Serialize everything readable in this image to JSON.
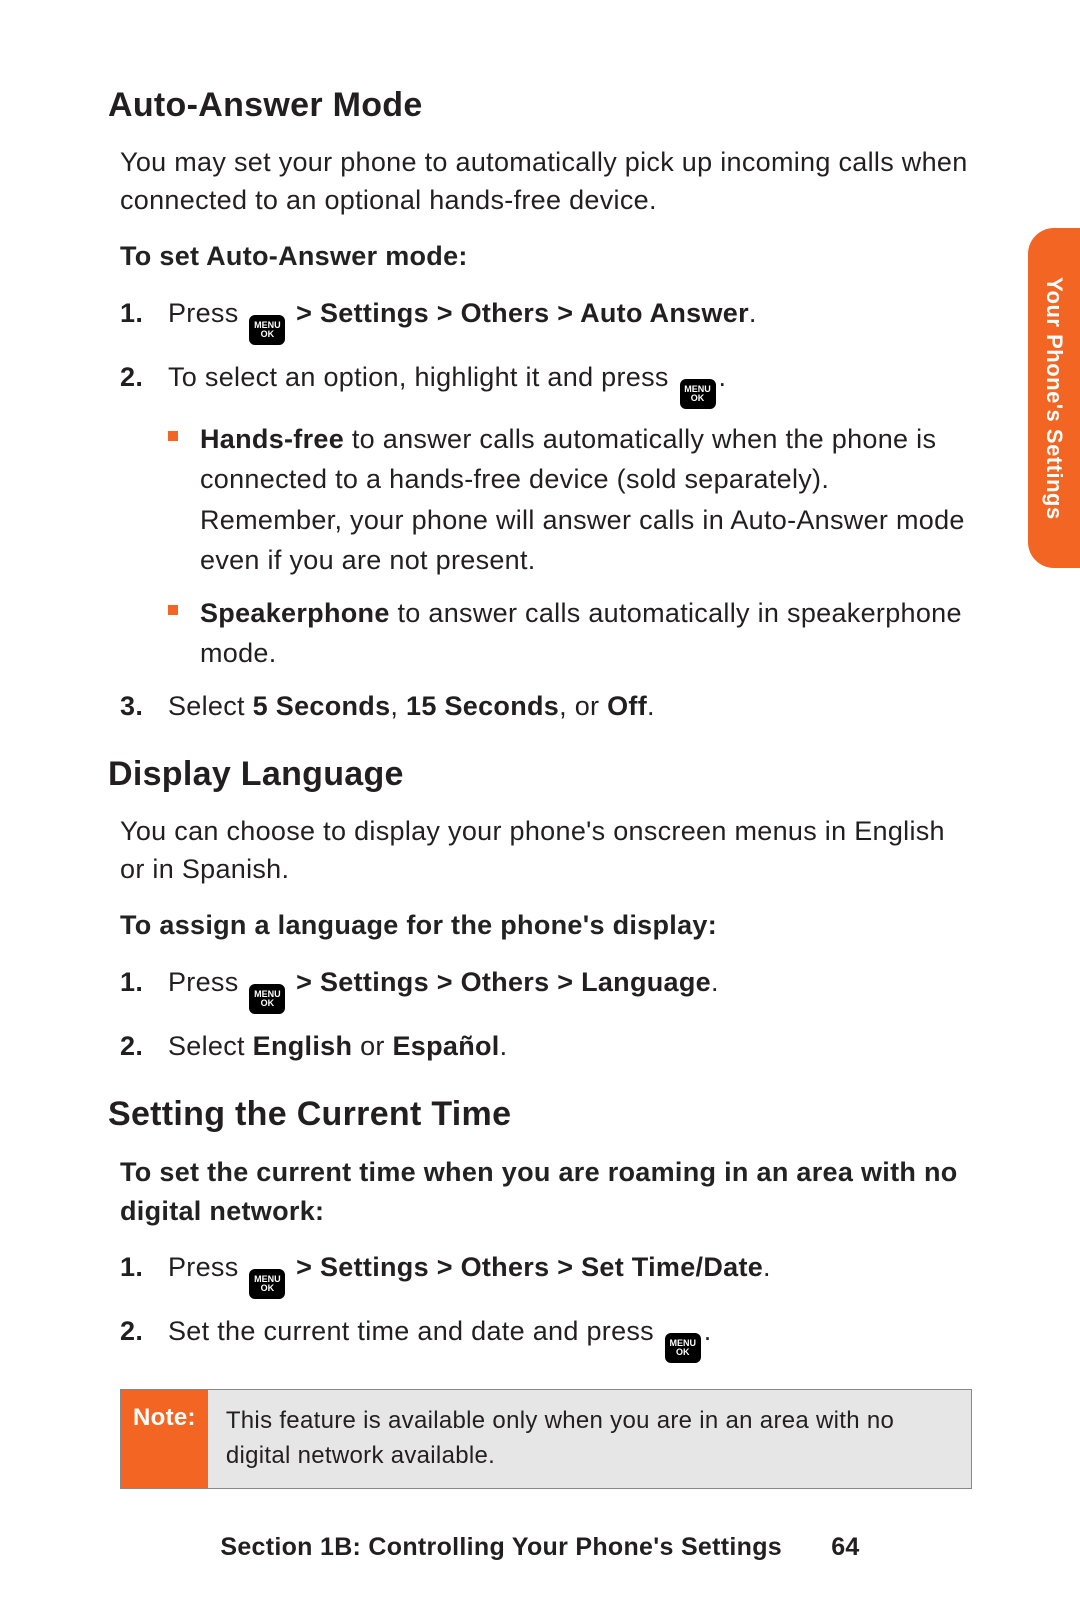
{
  "sidetab": "Your Phone's Settings",
  "menukey": {
    "l1": "MENU",
    "l2": "OK"
  },
  "sec1": {
    "h": "Auto-Answer Mode",
    "intro": "You may set your phone to automatically pick up incoming calls when connected to an optional hands-free device.",
    "sub": "To set Auto-Answer mode:",
    "s1a": "Press ",
    "s1b": " > Settings > Others > Auto Answer",
    "s1c": ".",
    "s2a": "To select an option, highlight it and press ",
    "s2b": ".",
    "b1a": "Hands-free",
    "b1b": " to answer calls automatically when the phone is connected to a hands-free device (sold separately). Remember, your phone will answer calls in Auto-Answer mode even if you are not present.",
    "b2a": "Speakerphone",
    "b2b": " to answer calls automatically in speakerphone mode.",
    "s3a": "Select ",
    "s3b": "5 Seconds",
    "s3c": ", ",
    "s3d": "15 Seconds",
    "s3e": ", or ",
    "s3f": "Off",
    "s3g": "."
  },
  "sec2": {
    "h": "Display Language",
    "intro": "You can choose to display your phone's onscreen menus in English or in Spanish.",
    "sub": "To assign a language for the phone's display:",
    "s1a": "Press ",
    "s1b": " > Settings > Others > Language",
    "s1c": ".",
    "s2a": "Select ",
    "s2b": "English",
    "s2c": " or ",
    "s2d": "Español",
    "s2e": "."
  },
  "sec3": {
    "h": "Setting the Current Time",
    "sub": "To set the current time when you are roaming in an area with no digital network:",
    "s1a": "Press ",
    "s1b": " > Settings > Others > Set Time/Date",
    "s1c": ".",
    "s2a": "Set the current time and date and press ",
    "s2b": "."
  },
  "note": {
    "label": "Note:",
    "body": "This feature is available only when you are in an area with no digital network available."
  },
  "footer": {
    "text": "Section 1B: Controlling Your Phone's Settings",
    "page": "64"
  }
}
